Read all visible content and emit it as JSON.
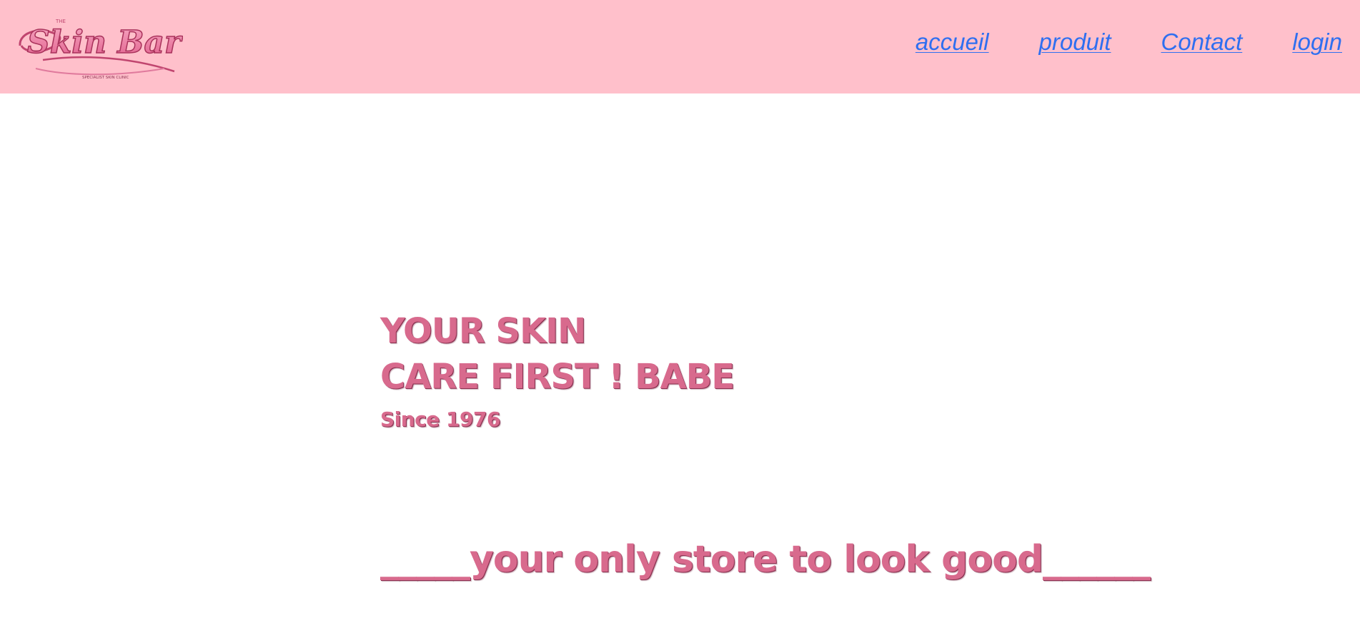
{
  "header": {
    "background_color": "#ffc0cb",
    "logo": {
      "icon": "skin-bar-logo",
      "main_text": "Skin Bar",
      "small_text_top": "THE",
      "small_text_bottom": "SPECIALIST SKIN CLINIC"
    },
    "nav": [
      {
        "label": "accueil"
      },
      {
        "label": "produit"
      },
      {
        "label": "Contact"
      },
      {
        "label": "login"
      }
    ],
    "link_color": "#2f6ff0"
  },
  "hero": {
    "line1": "YOUR SKIN",
    "line2": "CARE FIRST ! BABE",
    "since": "Since 1976",
    "tagline": "_____your only store to look good______",
    "text_color": "#d86a8d"
  }
}
